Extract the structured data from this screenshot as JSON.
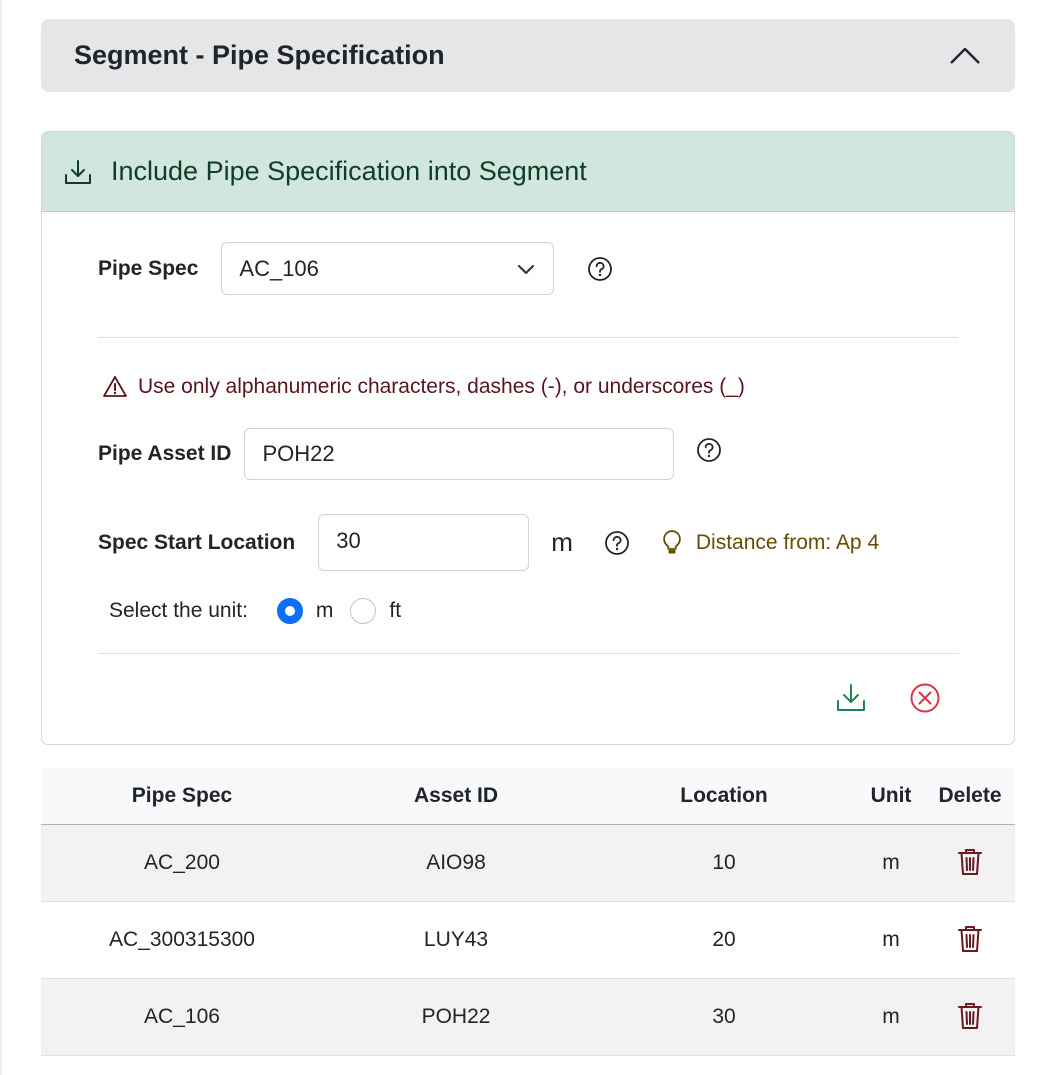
{
  "accordion": {
    "title": "Segment - Pipe Specification"
  },
  "card": {
    "title": "Include Pipe Specification into Segment",
    "pipe_spec": {
      "label": "Pipe Spec",
      "selected": "AC_106"
    },
    "warning": "Use only alphanumeric characters, dashes (-), or underscores (_)",
    "asset_id": {
      "label": "Pipe Asset ID",
      "value": "POH22"
    },
    "start_location": {
      "label": "Spec Start Location",
      "value": "30",
      "unit": "m",
      "hint": "Distance from: Ap 4"
    },
    "unit_select": {
      "label": "Select the unit:",
      "options": [
        "m",
        "ft"
      ],
      "selected": "m"
    }
  },
  "colors": {
    "header_bg": "#e5e6e8",
    "card_header_bg": "#d1e7dd",
    "success": "#198754",
    "danger": "#dc3545",
    "trash": "#6a1a21",
    "warning_text": "#58151c",
    "hint_text": "#664d03",
    "radio_checked": "#0d6efd"
  },
  "icons": {
    "collapse": "chevron-up-icon",
    "include": "download-icon",
    "help": "question-circle-icon",
    "warning": "exclamation-triangle-icon",
    "hint": "lightbulb-icon",
    "save": "download-icon",
    "cancel": "x-circle-icon",
    "delete": "trash-icon"
  },
  "table": {
    "columns": [
      "Pipe Spec",
      "Asset ID",
      "Location",
      "Unit",
      "Delete"
    ],
    "rows": [
      {
        "pipe_spec": "AC_200",
        "asset_id": "AIO98",
        "location": "10",
        "unit": "m"
      },
      {
        "pipe_spec": "AC_300315300",
        "asset_id": "LUY43",
        "location": "20",
        "unit": "m"
      },
      {
        "pipe_spec": "AC_106",
        "asset_id": "POH22",
        "location": "30",
        "unit": "m"
      }
    ]
  }
}
